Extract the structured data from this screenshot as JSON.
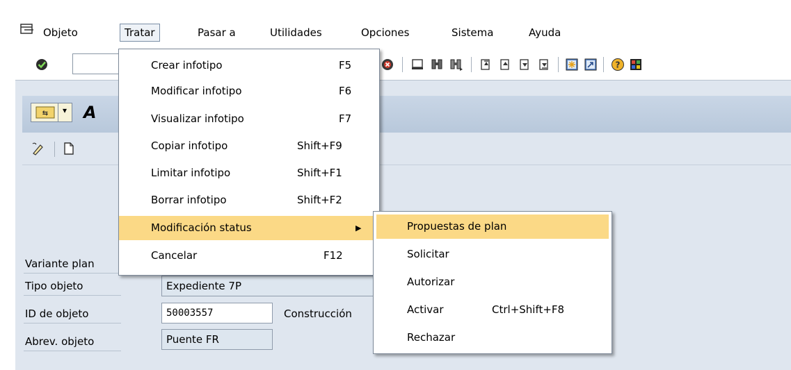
{
  "menubar": {
    "items": [
      {
        "label": "Objeto"
      },
      {
        "label": "Tratar"
      },
      {
        "label": "Pasar a"
      },
      {
        "label": "Utilidades"
      },
      {
        "label": "Opciones"
      },
      {
        "label": "Sistema"
      },
      {
        "label": "Ayuda"
      }
    ]
  },
  "title": {
    "initial": "A"
  },
  "form": {
    "fields": [
      {
        "label": "Variante plan",
        "value": ""
      },
      {
        "label": "Tipo objeto",
        "value": "Expediente 7P"
      },
      {
        "label": "ID de objeto",
        "value": "50003557",
        "extra": "Construcción"
      },
      {
        "label": "Abrev. objeto",
        "value": "Puente FR"
      }
    ]
  },
  "tratar_menu": {
    "items": [
      {
        "label": "Crear infotipo",
        "shortcut": "F5"
      },
      {
        "label": "Modificar infotipo",
        "shortcut": "F6"
      },
      {
        "label": "Visualizar infotipo",
        "shortcut": "F7"
      },
      {
        "label": "Copiar infotipo",
        "shortcut": "Shift+F9"
      },
      {
        "label": "Limitar infotipo",
        "shortcut": "Shift+F1"
      },
      {
        "label": "Borrar infotipo",
        "shortcut": "Shift+F2"
      },
      {
        "label": "Modificación status",
        "shortcut": ""
      },
      {
        "label": "Cancelar",
        "shortcut": "F12"
      }
    ]
  },
  "status_submenu": {
    "items": [
      {
        "label": "Propuestas de plan",
        "shortcut": ""
      },
      {
        "label": "Solicitar",
        "shortcut": ""
      },
      {
        "label": "Autorizar",
        "shortcut": ""
      },
      {
        "label": "Activar",
        "shortcut": "Ctrl+Shift+F8"
      },
      {
        "label": "Rechazar",
        "shortcut": ""
      }
    ]
  },
  "colors": {
    "highlight": "#fbd986",
    "window_bg": "#dfe6ef"
  },
  "icons": [
    "menu-icon",
    "enter-check-icon",
    "cancel-icon",
    "print-icon",
    "find-icon",
    "find-next-icon",
    "first-page-icon",
    "previous-page-icon",
    "next-page-icon",
    "last-page-icon",
    "create-session-icon",
    "shortcut-icon",
    "help-icon",
    "layout-icon",
    "other-object-icon",
    "edit-icon",
    "create-icon"
  ]
}
